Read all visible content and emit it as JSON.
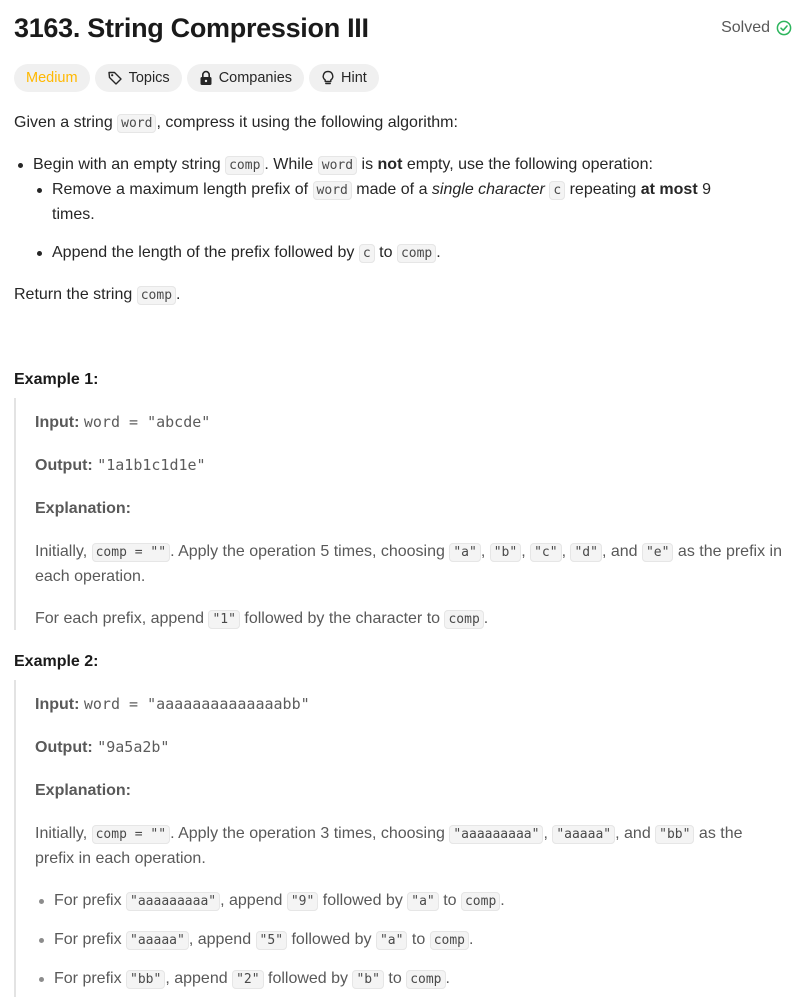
{
  "problem": {
    "title": "3163. String Compression III",
    "status": "Solved",
    "status_color": "#2db55d",
    "difficulty": "Medium",
    "difficulty_color": "#ffb800",
    "tags": {
      "topics": "Topics",
      "companies": "Companies",
      "hint": "Hint"
    }
  },
  "description": {
    "intro_a": "Given a string ",
    "intro_code": "word",
    "intro_b": ", compress it using the following algorithm:",
    "b1_a": "Begin with an empty string ",
    "b1_code1": "comp",
    "b1_b": ". While ",
    "b1_code2": "word",
    "b1_c": " is ",
    "b1_bold": "not",
    "b1_d": " empty, use the following operation:",
    "s1_a": "Remove a maximum length prefix of ",
    "s1_code1": "word",
    "s1_b": " made of a ",
    "s1_italic": "single character",
    "s1_code2": "c",
    "s1_c": " repeating ",
    "s1_bold": "at most",
    "s1_d": " 9 times.",
    "s2_a": "Append the length of the prefix followed by ",
    "s2_code1": "c",
    "s2_b": " to ",
    "s2_code2": "comp",
    "s2_c": ".",
    "ret_a": "Return the string ",
    "ret_code": "comp",
    "ret_b": "."
  },
  "examples": [
    {
      "heading": "Example 1:",
      "input_label": "Input:",
      "input_value": "word = \"abcde\"",
      "output_label": "Output:",
      "output_value": "\"1a1b1c1d1e\"",
      "explanation_label": "Explanation:",
      "exp1_a": "Initially, ",
      "exp1_code1": "comp = \"\"",
      "exp1_b": ". Apply the operation 5 times, choosing ",
      "exp1_code2": "\"a\"",
      "exp1_c": ", ",
      "exp1_code3": "\"b\"",
      "exp1_d": ", ",
      "exp1_code4": "\"c\"",
      "exp1_e": ", ",
      "exp1_code5": "\"d\"",
      "exp1_f": ", and ",
      "exp1_code6": "\"e\"",
      "exp1_g": " as the prefix in each operation.",
      "exp2_a": "For each prefix, append ",
      "exp2_code1": "\"1\"",
      "exp2_b": " followed by the character to ",
      "exp2_code2": "comp",
      "exp2_c": "."
    },
    {
      "heading": "Example 2:",
      "input_label": "Input:",
      "input_value": "word = \"aaaaaaaaaaaaaabb\"",
      "output_label": "Output:",
      "output_value": "\"9a5a2b\"",
      "explanation_label": "Explanation:",
      "exp1_a": "Initially, ",
      "exp1_code1": "comp = \"\"",
      "exp1_b": ". Apply the operation 3 times, choosing ",
      "exp1_code2": "\"aaaaaaaaa\"",
      "exp1_c": ", ",
      "exp1_code3": "\"aaaaa\"",
      "exp1_d": ", and ",
      "exp1_code4": "\"bb\"",
      "exp1_e": " as the prefix in each operation.",
      "bullets": [
        {
          "a": "For prefix ",
          "c1": "\"aaaaaaaaa\"",
          "b": ", append ",
          "c2": "\"9\"",
          "c": " followed by ",
          "c3": "\"a\"",
          "d": " to ",
          "c4": "comp",
          "e": "."
        },
        {
          "a": "For prefix ",
          "c1": "\"aaaaa\"",
          "b": ", append ",
          "c2": "\"5\"",
          "c": " followed by ",
          "c3": "\"a\"",
          "d": " to ",
          "c4": "comp",
          "e": "."
        },
        {
          "a": "For prefix ",
          "c1": "\"bb\"",
          "b": ", append ",
          "c2": "\"2\"",
          "c": " followed by ",
          "c3": "\"b\"",
          "d": " to ",
          "c4": "comp",
          "e": "."
        }
      ]
    }
  ]
}
